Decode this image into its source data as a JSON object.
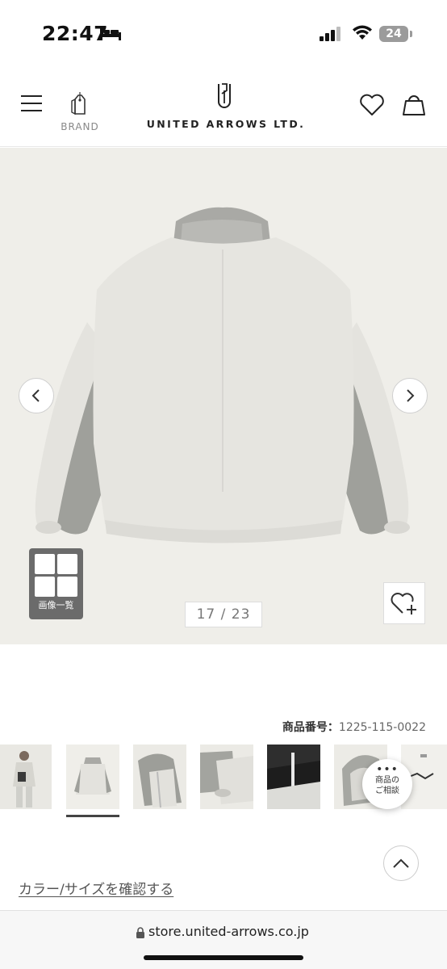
{
  "status_bar": {
    "time": "22:47",
    "battery": "24"
  },
  "header": {
    "brand_label": "BRAND",
    "logo_text": "UNITED ARROWS LTD."
  },
  "gallery": {
    "counter": "17 / 23",
    "grid_label": "画像一覧"
  },
  "product": {
    "number_label": "商品番号：",
    "number_value": "1225-115-0022"
  },
  "consult": {
    "dots": "•••",
    "line1": "商品の",
    "line2": "ご相談"
  },
  "links": {
    "color_size": "カラー/サイズを確認する"
  },
  "browser": {
    "url": "store.united-arrows.co.jp"
  },
  "icons": [
    "bed-icon",
    "signal-icon",
    "wifi-icon",
    "menu-icon",
    "brand-tag-icon",
    "logo-mark",
    "heart-icon",
    "bag-icon",
    "chevron-left-icon",
    "chevron-right-icon",
    "grid-icon",
    "heart-plus-icon",
    "chevron-up-icon",
    "lock-icon"
  ]
}
